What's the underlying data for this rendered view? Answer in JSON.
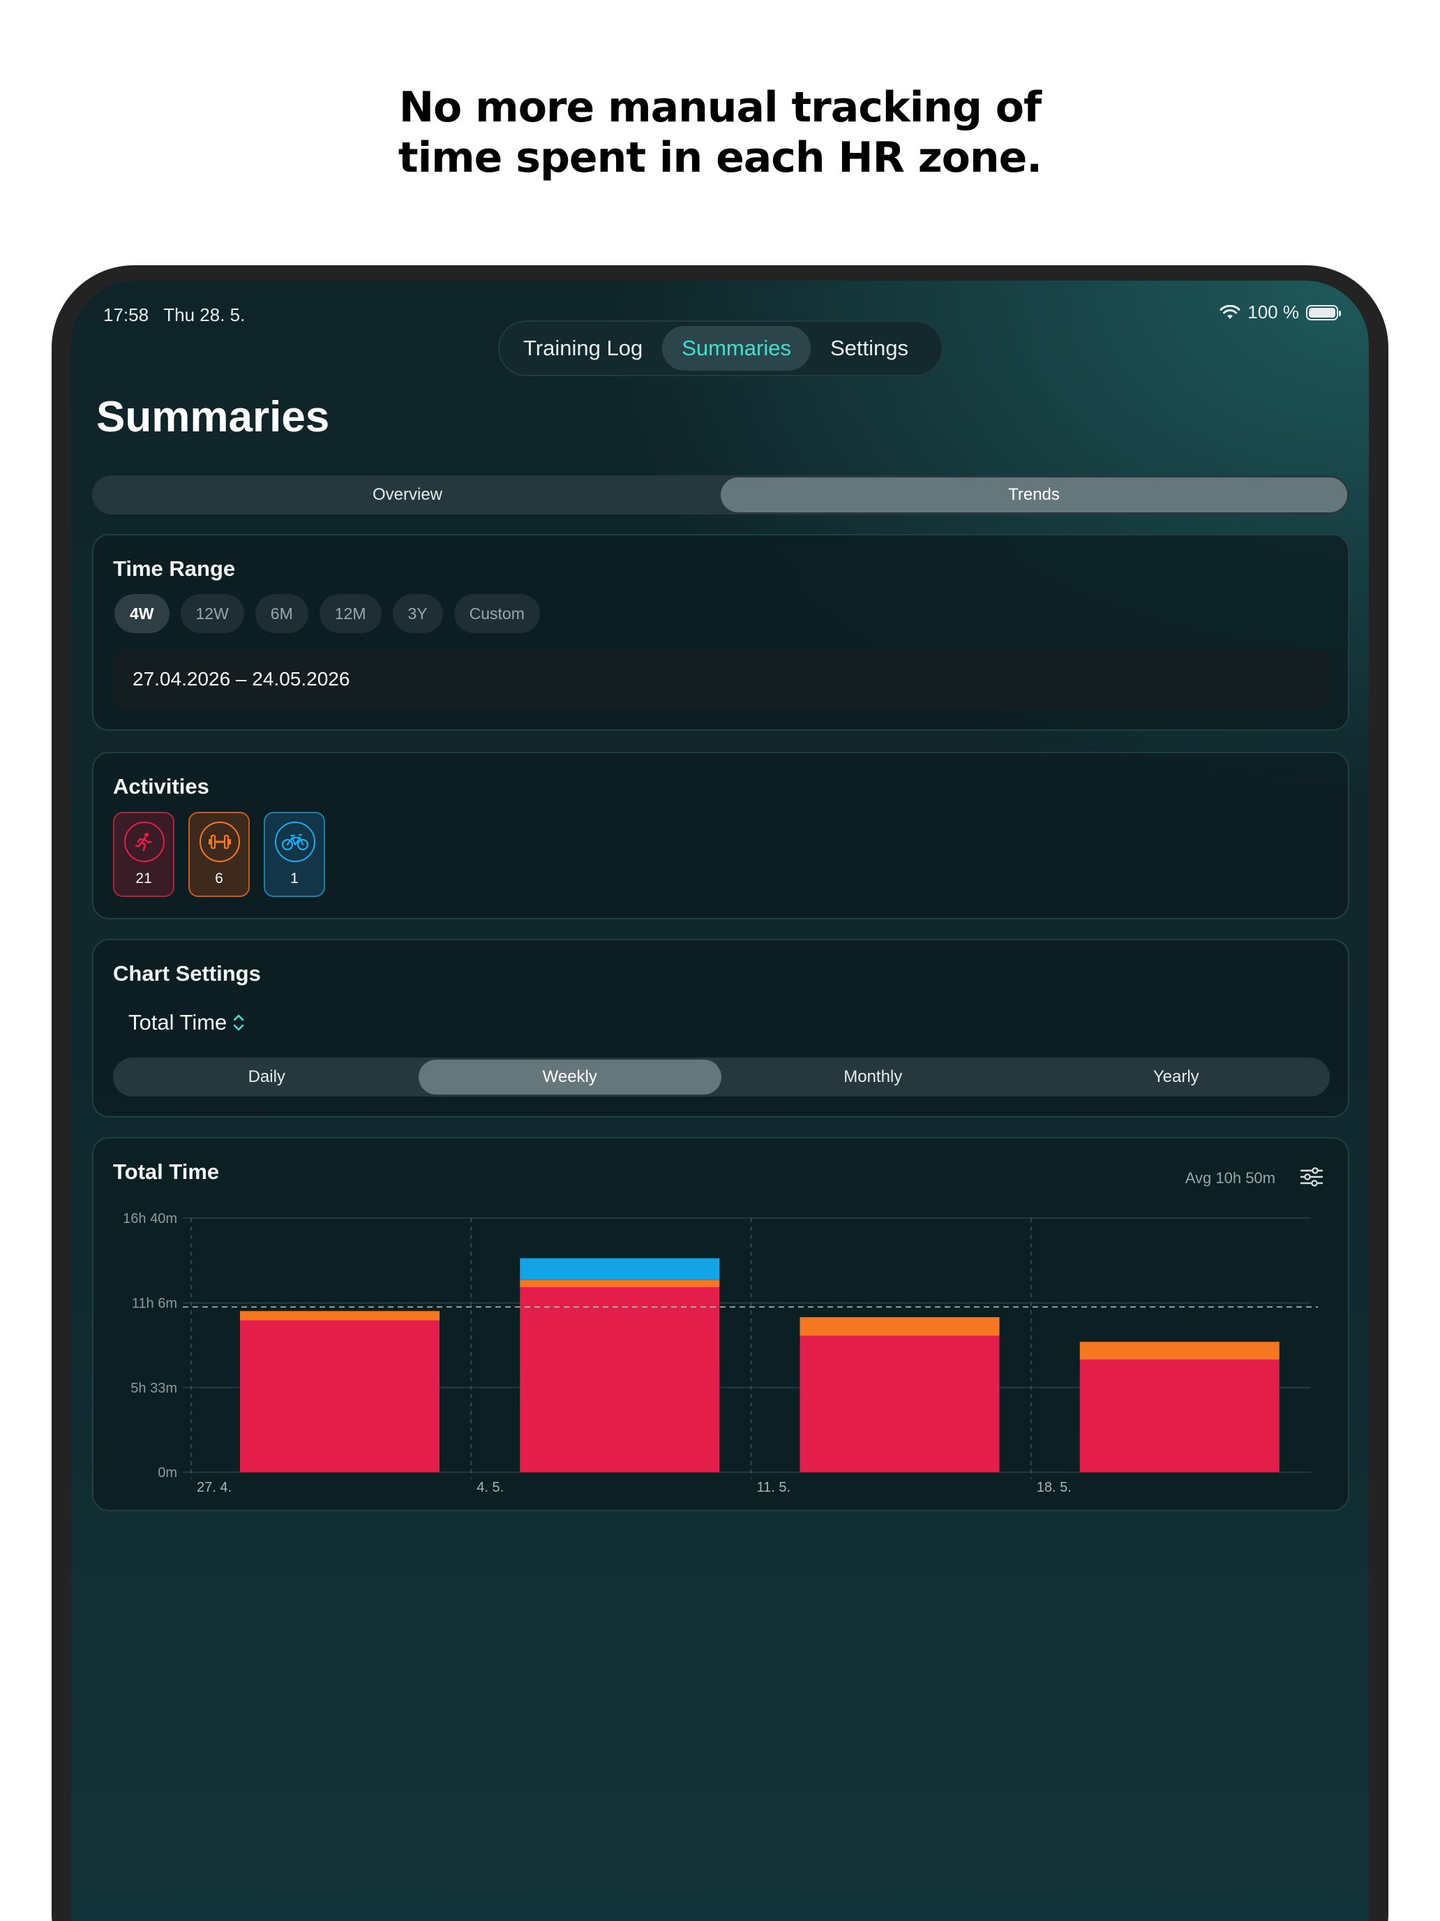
{
  "headline": {
    "line1": "No more manual tracking of",
    "line2": "time spent in each HR zone."
  },
  "status": {
    "time": "17:58",
    "date": "Thu 28. 5.",
    "battery": "100 %"
  },
  "tabs": [
    {
      "label": "Training Log",
      "active": false
    },
    {
      "label": "Summaries",
      "active": true
    },
    {
      "label": "Settings",
      "active": false
    }
  ],
  "title": "Summaries",
  "view_tabs": [
    {
      "label": "Overview",
      "active": false
    },
    {
      "label": "Trends",
      "active": true
    }
  ],
  "time_range": {
    "title": "Time Range",
    "options": [
      {
        "label": "4W",
        "active": true
      },
      {
        "label": "12W",
        "active": false
      },
      {
        "label": "6M",
        "active": false
      },
      {
        "label": "12M",
        "active": false
      },
      {
        "label": "3Y",
        "active": false
      },
      {
        "label": "Custom",
        "active": false
      }
    ],
    "date_range": "27.04.2026 – 24.05.2026"
  },
  "activities": {
    "title": "Activities",
    "items": [
      {
        "icon": "running-icon",
        "count": "21",
        "color": "#e51e4a"
      },
      {
        "icon": "dumbbell-icon",
        "count": "6",
        "color": "#f57a1e"
      },
      {
        "icon": "bicycle-icon",
        "count": "1",
        "color": "#1eaaee"
      }
    ]
  },
  "chart_settings": {
    "title": "Chart Settings",
    "metric": "Total Time",
    "periods": [
      {
        "label": "Daily",
        "active": false
      },
      {
        "label": "Weekly",
        "active": true
      },
      {
        "label": "Monthly",
        "active": false
      },
      {
        "label": "Yearly",
        "active": false
      }
    ]
  },
  "chart_card": {
    "title": "Total Time",
    "avg_label": "Avg 10h 50m"
  },
  "chart_data": {
    "type": "bar",
    "stacked": true,
    "title": "Total Time",
    "categories": [
      "27. 4.",
      "4. 5.",
      "11. 5.",
      "18. 5."
    ],
    "unit": "minutes",
    "y_ticks": [
      {
        "value": 0,
        "label": "0m"
      },
      {
        "value": 333,
        "label": "5h 33m"
      },
      {
        "value": 666,
        "label": "11h 6m"
      },
      {
        "value": 1000,
        "label": "16h 40m"
      }
    ],
    "ylim": [
      0,
      1000
    ],
    "average": 650,
    "series": [
      {
        "values": [
          597,
          728,
          537,
          443
        ],
        "color": "#e31e4a"
      },
      {
        "values": [
          37,
          28,
          73,
          70
        ],
        "color": "#f57820"
      },
      {
        "values": [
          0,
          86,
          0,
          0
        ],
        "color": "#13a4e8"
      }
    ],
    "grid": true
  }
}
